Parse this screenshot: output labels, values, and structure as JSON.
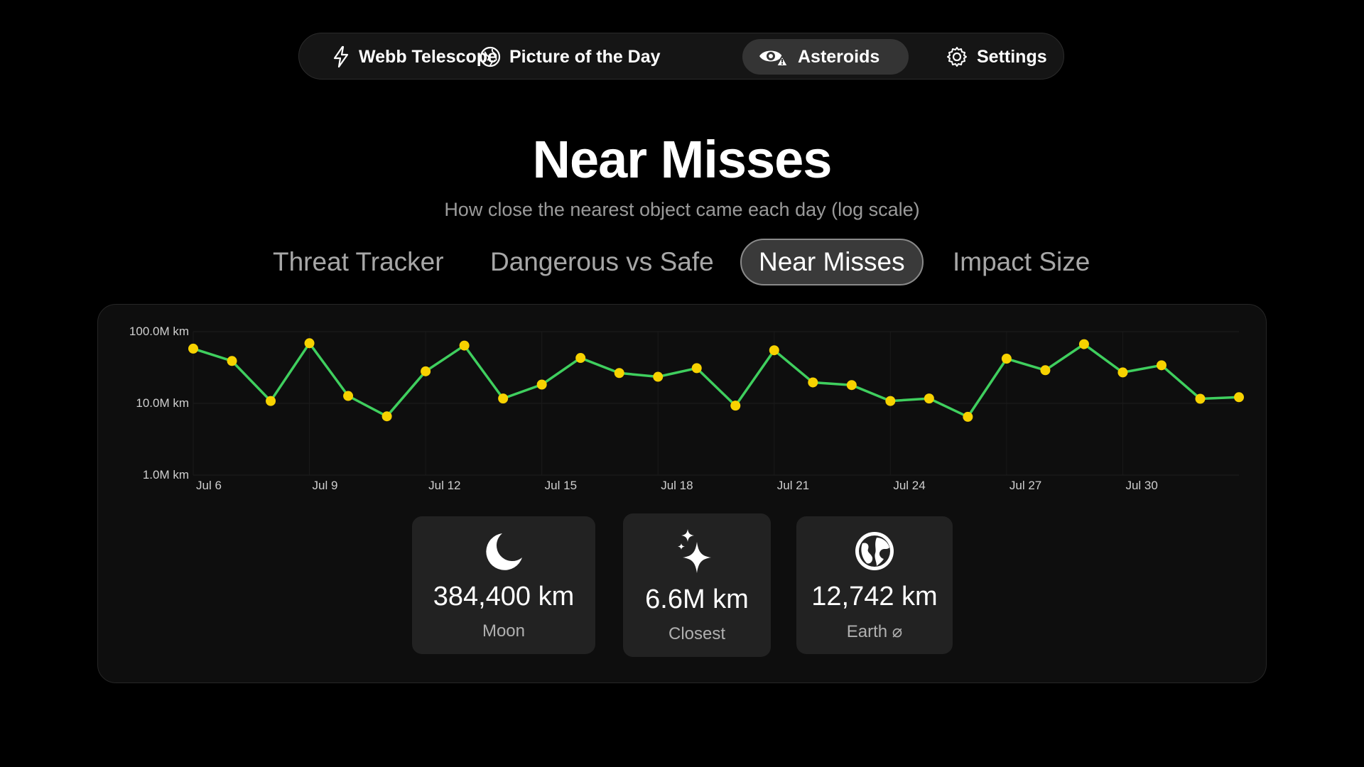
{
  "nav": {
    "items": [
      {
        "label": "Webb Telescope",
        "icon": "lightning-icon",
        "active": false
      },
      {
        "label": "Picture of the Day",
        "icon": "globe-icon",
        "active": false
      },
      {
        "label": "Asteroids",
        "icon": "eye-warning-icon",
        "active": true
      },
      {
        "label": "Settings",
        "icon": "gear-icon",
        "active": false
      }
    ]
  },
  "header": {
    "title": "Near Misses",
    "subtitle": "How close the nearest object came each day (log scale)"
  },
  "tabs": [
    {
      "label": "Threat Tracker",
      "active": false
    },
    {
      "label": "Dangerous vs Safe",
      "active": false
    },
    {
      "label": "Near Misses",
      "active": true
    },
    {
      "label": "Impact Size",
      "active": false
    }
  ],
  "chart_data": {
    "type": "line",
    "title": "",
    "xlabel": "",
    "ylabel": "",
    "y_scale": "log",
    "y_unit": "km",
    "ylim": [
      1000000,
      100000000
    ],
    "y_ticks": [
      {
        "value": 100000000,
        "label": "100.0M km"
      },
      {
        "value": 10000000,
        "label": "10.0M km"
      },
      {
        "value": 1000000,
        "label": "1.0M km"
      }
    ],
    "x": [
      "Jul 6",
      "Jul 7",
      "Jul 8",
      "Jul 9",
      "Jul 10",
      "Jul 11",
      "Jul 12",
      "Jul 13",
      "Jul 14",
      "Jul 15",
      "Jul 16",
      "Jul 17",
      "Jul 18",
      "Jul 19",
      "Jul 20",
      "Jul 21",
      "Jul 22",
      "Jul 23",
      "Jul 24",
      "Jul 25",
      "Jul 26",
      "Jul 27",
      "Jul 28",
      "Jul 29",
      "Jul 30",
      "Jul 31",
      "Aug 1",
      "Aug 2"
    ],
    "x_tick_labels": [
      "Jul 6",
      "Jul 9",
      "Jul 12",
      "Jul 15",
      "Jul 18",
      "Jul 21",
      "Jul 24",
      "Jul 27",
      "Jul 30"
    ],
    "series": [
      {
        "values": [
          58000000,
          39000000,
          10800000,
          69000000,
          12700000,
          6600000,
          28000000,
          64000000,
          11700000,
          18300000,
          43000000,
          26500000,
          23500000,
          31000000,
          9300000,
          55000000,
          19600000,
          18000000,
          10800000,
          11700000,
          6500000,
          42000000,
          29000000,
          67000000,
          27000000,
          34000000,
          11600000,
          12200000
        ],
        "line_color": "#3fcf5e",
        "marker_color": "#f7d200"
      }
    ],
    "grid": true,
    "legend": "none"
  },
  "stats": [
    {
      "icon": "moon-icon",
      "value": "384,400 km",
      "label": "Moon"
    },
    {
      "icon": "sparkles-icon",
      "value": "6.6M km",
      "label": "Closest"
    },
    {
      "icon": "earth-icon",
      "value": "12,742 km",
      "label": "Earth ⌀"
    }
  ]
}
